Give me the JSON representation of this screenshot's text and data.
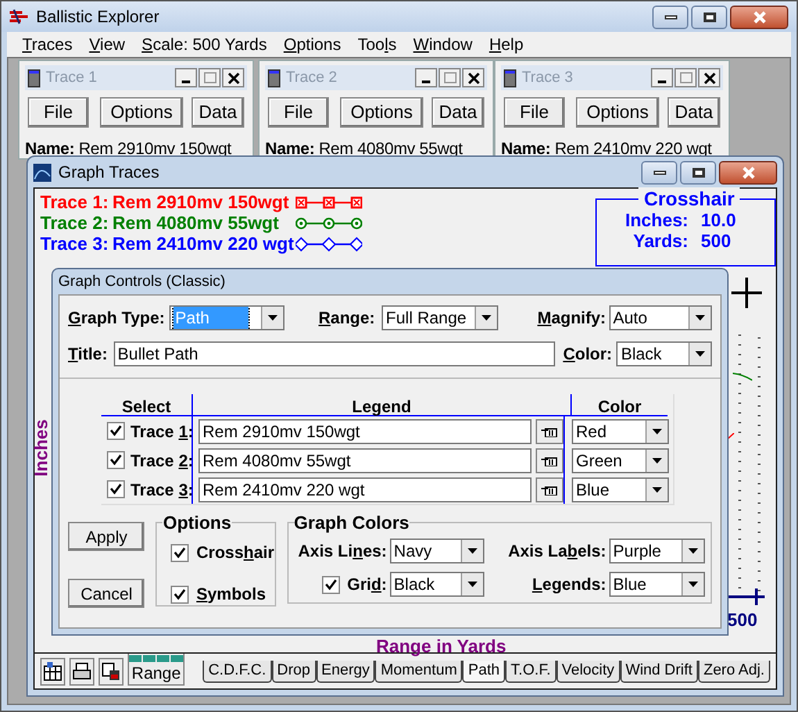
{
  "window": {
    "title": "Ballistic Explorer"
  },
  "menu": [
    {
      "key": "T",
      "post": "races"
    },
    {
      "key": "V",
      "post": "iew"
    },
    {
      "key": "S",
      "post": "cale: 500 Yards"
    },
    {
      "key": "O",
      "post": "ptions"
    },
    {
      "pre": "Too",
      "key": "l",
      "post": "s"
    },
    {
      "key": "W",
      "post": "indow"
    },
    {
      "key": "H",
      "post": "elp"
    }
  ],
  "trace_windows": [
    {
      "title": "Trace 1",
      "buttons": [
        "File",
        "Options",
        "Data"
      ],
      "name_label": "Name:",
      "name": "Rem 2910mv 150wgt"
    },
    {
      "title": "Trace 2",
      "buttons": [
        "File",
        "Options",
        "Data"
      ],
      "name_label": "Name:",
      "name": "Rem 4080mv 55wgt"
    },
    {
      "title": "Trace 3",
      "buttons": [
        "File",
        "Options",
        "Data"
      ],
      "name_label": "Name:",
      "name": "Rem 2410mv 220 wgt"
    }
  ],
  "graph_window": {
    "title": "Graph Traces",
    "legend": [
      {
        "label": "Trace 1:",
        "name": "Rem 2910mv 150wgt",
        "color": "#ff0000",
        "kind": "square"
      },
      {
        "label": "Trace 2:",
        "name": "Rem 4080mv 55wgt",
        "color": "#008000",
        "kind": "circle"
      },
      {
        "label": "Trace 3:",
        "name": "Rem 2410mv 220 wgt",
        "color": "#0000ff",
        "kind": "diamond"
      }
    ],
    "crosshair": {
      "title": "Crosshair",
      "rows": [
        {
          "label": "Inches:",
          "value": "10.0"
        },
        {
          "label": "Yards:",
          "value": "500"
        }
      ]
    },
    "y_axis_label": "Inches",
    "x_axis_label": "Range in Yards",
    "x_tick": "500",
    "range_button": "Range",
    "tabs": [
      {
        "label": "C.D.F.C.",
        "selected": false
      },
      {
        "label": "Drop",
        "selected": false
      },
      {
        "label": "Energy",
        "selected": false
      },
      {
        "label": "Momentum",
        "selected": false
      },
      {
        "label": "Path",
        "selected": true
      },
      {
        "label": "T.O.F.",
        "selected": false
      },
      {
        "label": "Velocity",
        "selected": false
      },
      {
        "label": "Wind Drift",
        "selected": false
      },
      {
        "label": "Zero Adj.",
        "selected": false
      }
    ]
  },
  "dialog": {
    "title": "Graph Controls (Classic)",
    "graph_type": {
      "key": "G",
      "post": "raph Type:",
      "value": "Path"
    },
    "range": {
      "key": "R",
      "post": "ange:",
      "value": "Full Range"
    },
    "magnify": {
      "key": "M",
      "post": "agnify:",
      "value": "Auto"
    },
    "title_field": {
      "key": "T",
      "post": "itle:",
      "value": "Bullet Path"
    },
    "color": {
      "key": "C",
      "post": "olor:",
      "value": "Black"
    },
    "columns": [
      "Select",
      "Legend",
      "Color"
    ],
    "rows": [
      {
        "pre": "Trace ",
        "key": "1",
        "post": ":",
        "checked": true,
        "legend": "Rem 2910mv 150wgt",
        "color_name": "Red"
      },
      {
        "pre": "Trace ",
        "key": "2",
        "post": ":",
        "checked": true,
        "legend": "Rem 4080mv 55wgt",
        "color_name": "Green"
      },
      {
        "pre": "Trace ",
        "key": "3",
        "post": ":",
        "checked": true,
        "legend": "Rem 2410mv 220 wgt",
        "color_name": "Blue"
      }
    ],
    "buttons": [
      "Apply",
      "Cancel"
    ],
    "options": {
      "title": "Options",
      "items": [
        {
          "pre": "Cross",
          "key": "h",
          "post": "air",
          "checked": true
        },
        {
          "key": "S",
          "post": "ymbols",
          "checked": true
        }
      ]
    },
    "graph_colors": {
      "title": "Graph Colors",
      "axis_lines": {
        "pre": "Axis Li",
        "key": "n",
        "post": "es:",
        "value": "Navy"
      },
      "grid": {
        "pre": "Gri",
        "key": "d",
        "post": ":",
        "value": "Black",
        "checked": true
      },
      "axis_labels": {
        "pre": "Axis La",
        "key": "b",
        "post": "els:",
        "value": "Purple"
      },
      "legends": {
        "key": "L",
        "post": "egends:",
        "value": "Blue"
      }
    }
  }
}
